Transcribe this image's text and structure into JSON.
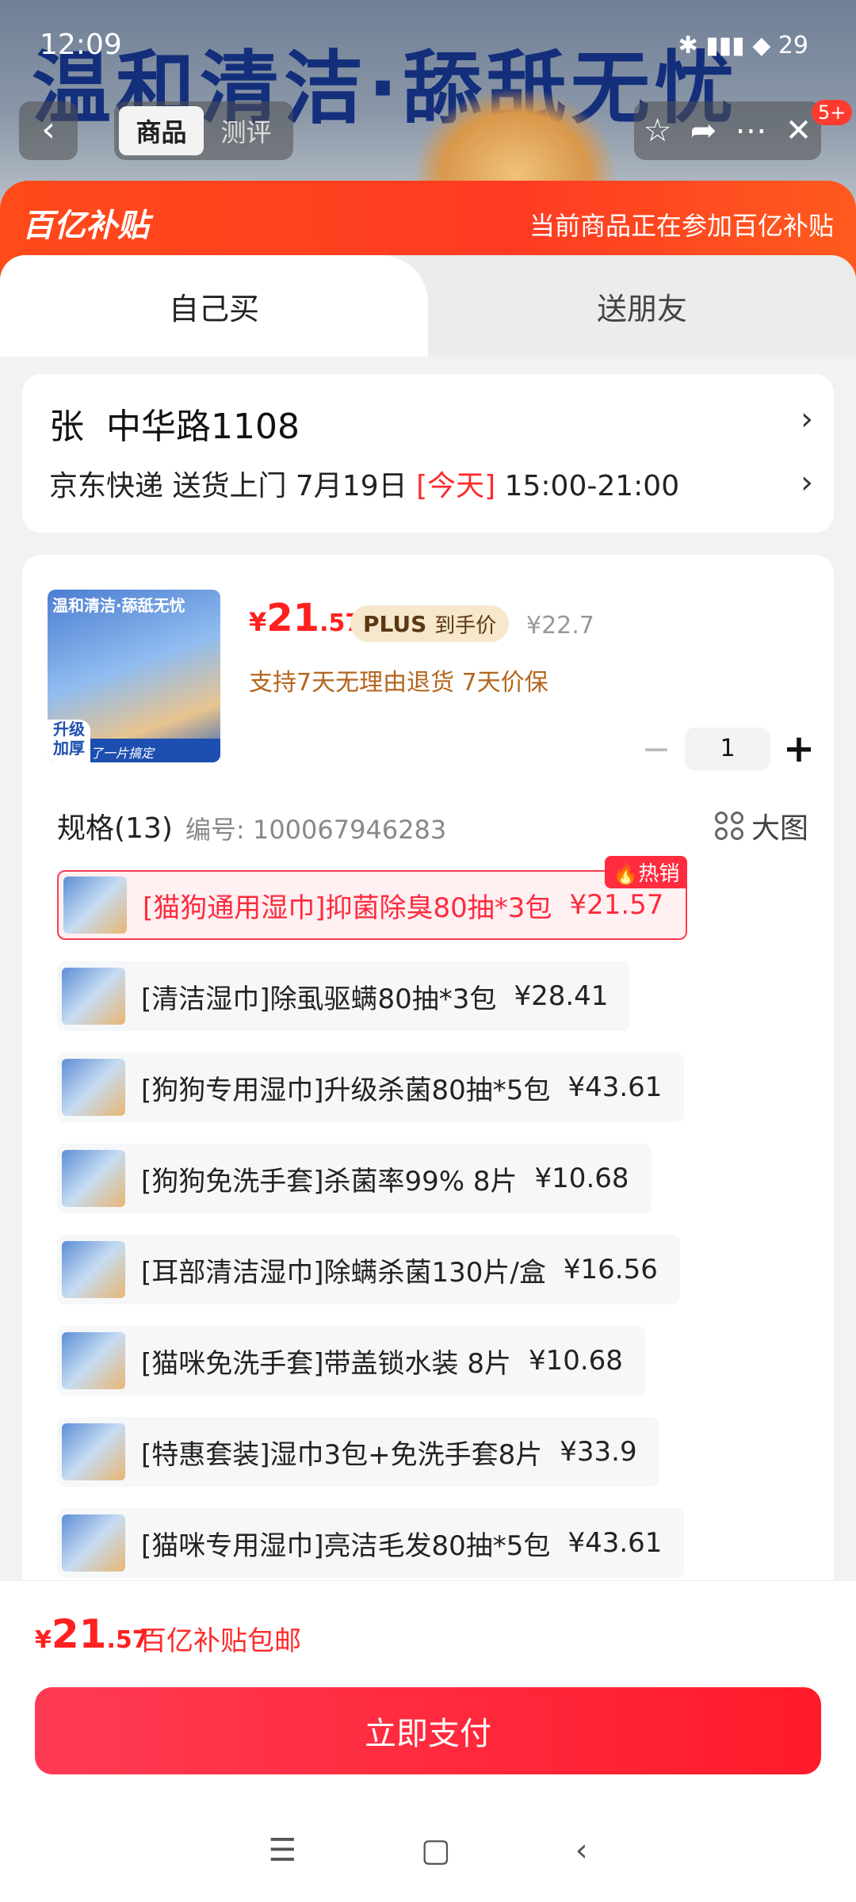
{
  "status_bar": {
    "time": "12:09",
    "battery": "29"
  },
  "hero": {
    "text": "温和清洁·舔舐无忧"
  },
  "top_nav": {
    "tabs": [
      {
        "label": "商品"
      },
      {
        "label": "测评"
      }
    ],
    "badge": "5+"
  },
  "subsidy_banner": {
    "logo": "百亿补贴",
    "note": "当前商品正在参加百亿补贴"
  },
  "buy_tabs": [
    {
      "label": "自己买"
    },
    {
      "label": "送朋友"
    }
  ],
  "address": {
    "name": "张",
    "street": "中华路1108",
    "delivery_prefix": "京东快递 送货上门 7月19日",
    "delivery_today": "[今天]",
    "delivery_window": "15:00-21:00"
  },
  "product": {
    "image_title": "温和清洁·舔舐无忧",
    "image_badge": "升级加厚",
    "image_tagline": "脏了臭了一片搞定",
    "price_symbol": "¥",
    "price_int": "21",
    "price_dec": ".57",
    "plus_label": "PLUS",
    "plus_sub": "到手价",
    "original_price": "¥22.7",
    "promo": "支持7天无理由退货  7天价保",
    "quantity": "1"
  },
  "specs": {
    "heading": "规格(13)",
    "code": "编号: 100067946283",
    "big_image_label": "大图",
    "items": [
      {
        "label": "[猫狗通用湿巾]抑菌除臭80抽*3包",
        "price": "¥21.57",
        "selected": true,
        "hot": "热销"
      },
      {
        "label": "[清洁湿巾]除虱驱螨80抽*3包",
        "price": "¥28.41"
      },
      {
        "label": "[狗狗专用湿巾]升级杀菌80抽*5包",
        "price": "¥43.61"
      },
      {
        "label": "[狗狗免洗手套]杀菌率99% 8片",
        "price": "¥10.68"
      },
      {
        "label": "[耳部清洁湿巾]除螨杀菌130片/盒",
        "price": "¥16.56"
      },
      {
        "label": "[猫咪免洗手套]带盖锁水装 8片",
        "price": "¥10.68"
      },
      {
        "label": "[特惠套装]湿巾3包+免洗手套8片",
        "price": "¥33.9"
      },
      {
        "label": "[猫咪专用湿巾]亮洁毛发80抽*5包",
        "price": "¥43.61"
      }
    ]
  },
  "footer": {
    "total_symbol": "¥",
    "total_int": "21",
    "total_dec": ".57",
    "total_note": "百亿补贴包邮",
    "pay_button": "立即支付"
  },
  "colors": {
    "accent": "#ff2a3c",
    "banner": "#ff4a1a",
    "promo": "#b5651d"
  },
  "icons": [
    "back-icon",
    "star-icon",
    "share-icon",
    "more-icon",
    "close-icon",
    "chevron-right-icon",
    "minus-icon",
    "plus-icon",
    "grid-icon",
    "flame-icon",
    "menu-icon",
    "home-icon",
    "nav-back-icon"
  ]
}
